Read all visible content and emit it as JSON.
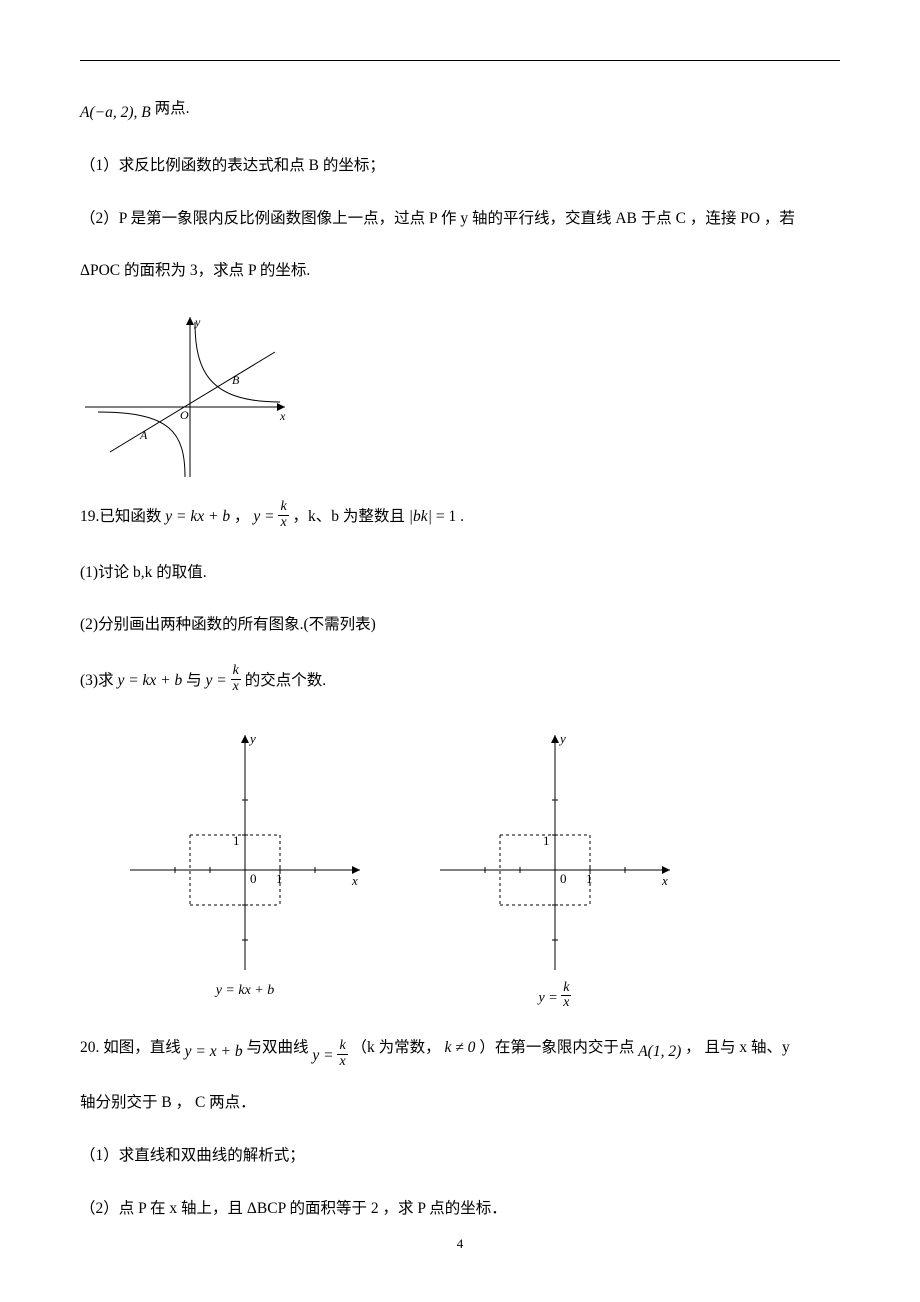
{
  "intro": {
    "points": "A(−a, 2), B",
    "suffix": "两点."
  },
  "q_part1": "（1）求反比例函数的表达式和点 B 的坐标；",
  "q_part2_a": "（2）P 是第一象限内反比例函数图像上一点，过点 P 作 y 轴的平行线，交直线 AB 于点 C ，连接 PO ，若",
  "q_part2_b_prefix": "ΔPOC 的面积为 3，求点 P 的坐标.",
  "fig1": {
    "y": "y",
    "x": "x",
    "O": "O",
    "A": "A",
    "B": "B"
  },
  "q19": {
    "stem_a": "19.已知函数 ",
    "eq1": "y = kx + b",
    "sep1": " ，  ",
    "eq2_lhs": "y =",
    "sep2": "，k、b 为整数且",
    "abs": "|bk|",
    "eq3": "= 1",
    "period": ".",
    "p1": "(1)讨论 b,k 的取值.",
    "p2": "(2)分别画出两种函数的所有图象.(不需列表)",
    "p3_a": "(3)求 ",
    "p3_eq1": "y = kx + b",
    "p3_mid": " 与 ",
    "p3_eq2_lhs": "y =",
    "p3_b": " 的交点个数."
  },
  "grids": {
    "y": "y",
    "x": "x",
    "O": "0",
    "one": "1",
    "cap1": "y = kx + b",
    "cap2_lhs": "y ="
  },
  "q20": {
    "line1_a": "20.  如图，直线 ",
    "eq1": "y = x + b",
    "line1_b": " 与双曲线 ",
    "eq2_lhs": "y =",
    "line1_c": " （k 为常数， ",
    "neq": "k ≠ 0",
    "line1_d": "）在第一象限内交于点 ",
    "pointA": "A(1, 2)",
    "line1_e": "， 且与 x 轴、y",
    "line2": "轴分别交于 B ， C 两点．",
    "p1": "（1）求直线和双曲线的解析式；",
    "p2": "（2）点 P 在 x 轴上，且 ΔBCP 的面积等于 2 ，求 P 点的坐标．"
  },
  "page_number": "4"
}
